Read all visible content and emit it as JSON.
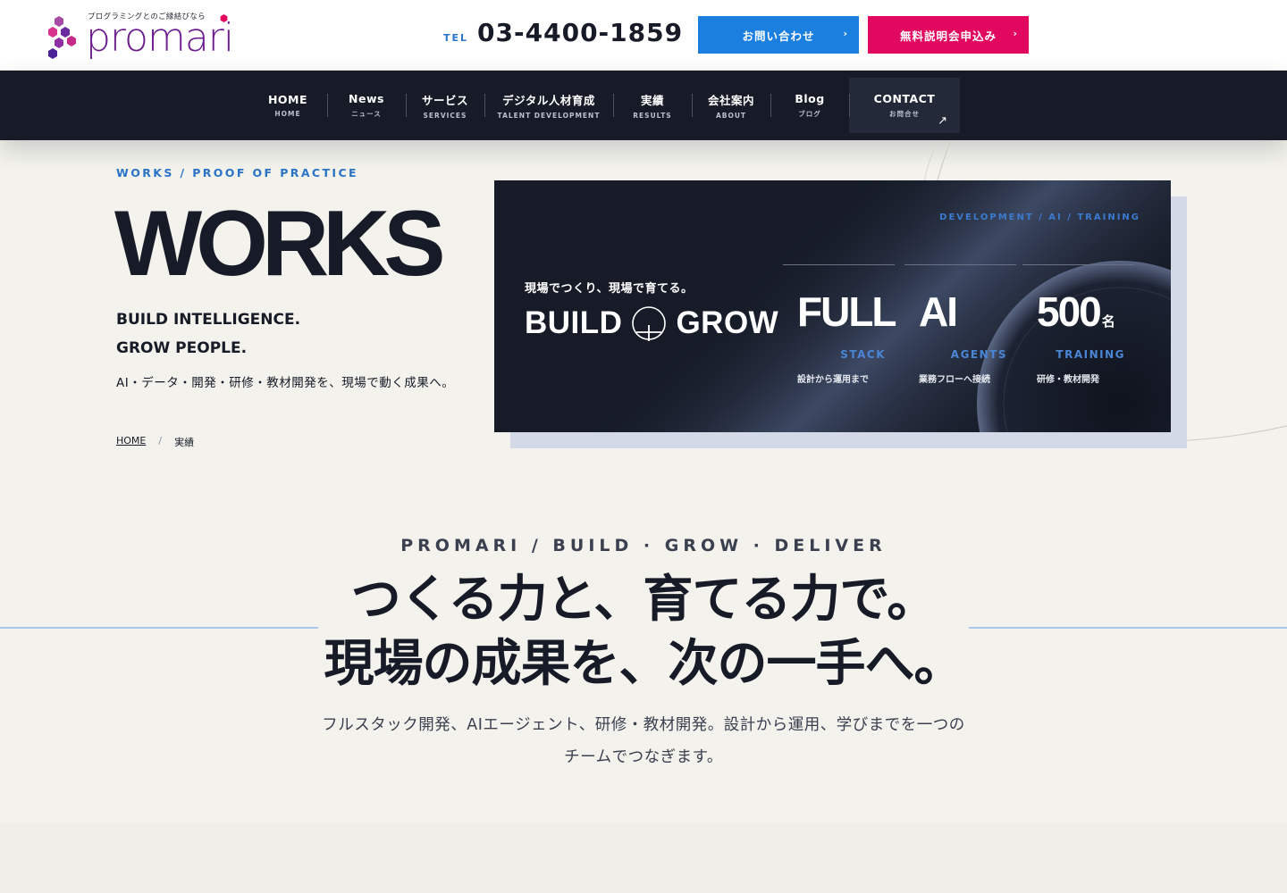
{
  "header": {
    "logo_tagline": "プログラミングとのご縁結びなら",
    "logo_word": "promari",
    "tel_label": "TEL",
    "tel_number": "03-4400-1859",
    "contact_button": "お問い合わせ",
    "seminar_button": "無料説明会申込み",
    "chevron": "›"
  },
  "nav": {
    "items": [
      {
        "label": "HOME",
        "sub": "HOME"
      },
      {
        "label": "News",
        "sub": "ニュース"
      },
      {
        "label": "サービス",
        "sub": "SERVICES"
      },
      {
        "label": "デジタル人材育成",
        "sub": "TALENT DEVELOPMENT"
      },
      {
        "label": "実績",
        "sub": "RESULTS"
      },
      {
        "label": "会社案内",
        "sub": "ABOUT"
      },
      {
        "label": "Blog",
        "sub": "ブログ"
      },
      {
        "label": "CONTACT",
        "sub": "お問合せ"
      }
    ],
    "contact_arrow": "↗"
  },
  "hero": {
    "eyebrow": "WORKS / PROOF OF PRACTICE",
    "title": "WORKS",
    "tagline_1": "BUILD INTELLIGENCE.",
    "tagline_2": "GROW PEOPLE.",
    "description": "AI・データ・開発・研修・教材開発を、現場で動く成果へ。",
    "breadcrumb_home": "HOME",
    "breadcrumb_sep": "/",
    "breadcrumb_current": "実績"
  },
  "card": {
    "tag": "DEVELOPMENT / AI / TRAINING",
    "jp_line": "現場でつくり、現場で育てる。",
    "build_word": "BUILD",
    "grow_word": "GROW",
    "stats": [
      {
        "value": "FULL",
        "unit": "",
        "label": "STACK",
        "desc": "設計から運用まで"
      },
      {
        "value": "AI",
        "unit": "",
        "label": "AGENTS",
        "desc": "業務フローへ接続"
      },
      {
        "value": "500",
        "unit": "名",
        "label": "TRAINING",
        "desc": "研修・教材開発"
      }
    ]
  },
  "intro": {
    "eyebrow": "PROMARI / BUILD · GROW · DELIVER",
    "heading_1": "つくる力と、育てる力で。",
    "heading_2": "現場の成果を、次の一手へ。",
    "body_1": "フルスタック開発、AIエージェント、研修・教材開発。設計から運用、学びまでを一つの",
    "body_2": "チームでつなぎます。"
  },
  "colors": {
    "navy": "#161b27",
    "accent_blue": "#1b7fe0",
    "accent_pink": "#e2075f",
    "logo_purple": "#6d1f8f",
    "label_blue": "#2a73c7"
  },
  "icons": {
    "logo_mark": "hexagon-cluster-icon",
    "plus": "plus-circle-icon",
    "chevron": "chevron-right-icon",
    "arrow": "arrow-up-right-icon"
  }
}
